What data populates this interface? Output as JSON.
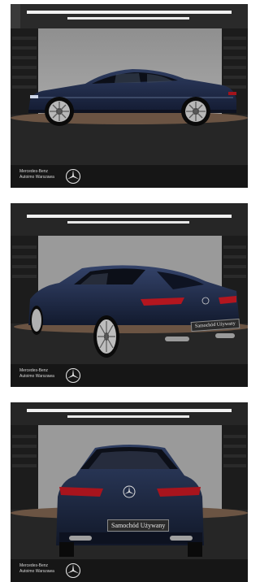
{
  "gallery": {
    "photos": [
      {
        "brand_line_1": "Mercedes-Benz",
        "brand_line_2": "Autoimo Warszawa"
      },
      {
        "brand_line_1": "Mercedes-Benz",
        "brand_line_2": "Autoimo Warszawa",
        "plate_text": "Samochód Używany"
      },
      {
        "brand_line_1": "Mercedes-Benz",
        "brand_line_2": "Autoimo Warszawa",
        "plate_text": "Samochód Używany"
      }
    ]
  },
  "colors": {
    "car_paint": "#1e2b4a",
    "backdrop": "#9a9a9a",
    "floor": "#262626",
    "brand_bar": "#161616"
  }
}
